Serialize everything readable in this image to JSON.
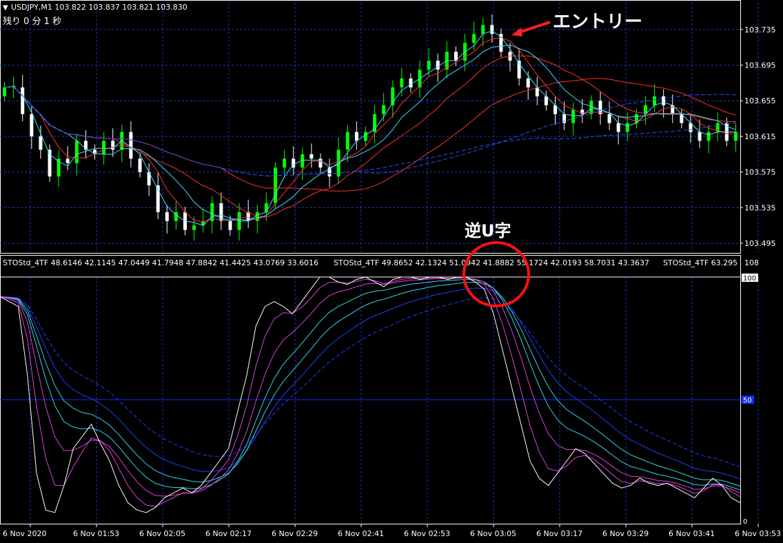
{
  "header": {
    "symbol_line": "USDJPY,M1  103.822 103.837 103.821 103.830",
    "countdown": "残り 0 分 1 秒"
  },
  "price_axis": [
    "103.735",
    "103.695",
    "103.655",
    "103.615",
    "103.575",
    "103.535",
    "103.495"
  ],
  "indicator": {
    "legend_a": "STOStd_4TF 48.6146 42.1145 47.0449 41.7948 47.8842 41.4425 43.0769 33.6016",
    "legend_b": "STOStd_4TF 49.8652 42.1324 51.0942 41.8882 55.1724 42.0193 58.7031 43.3637",
    "legend_c": "STOStd_4TF 63.295",
    "axis_top": "108",
    "axis_100": "100",
    "axis_50": "50",
    "axis_0": "0"
  },
  "time_axis": [
    "6 Nov 2020",
    "6 Nov 01:53",
    "6 Nov 02:05",
    "6 Nov 02:17",
    "6 Nov 02:29",
    "6 Nov 02:41",
    "6 Nov 02:53",
    "6 Nov 03:05",
    "6 Nov 03:17",
    "6 Nov 03:29",
    "6 Nov 03:41",
    "6 Nov 03:53"
  ],
  "annotations": {
    "entry": "エントリー",
    "inverse_u": "逆U字"
  },
  "colors": {
    "bull": "#00ff00",
    "bear": "#ffffff",
    "grid": "#1e3cc8",
    "axis": "#ffffff",
    "arrow": "#ff2020",
    "circle": "#ff1010",
    "ma_red": "#ff3030",
    "ma_cyan": "#40e0ff",
    "ma_blue": "#2850ff",
    "sto_main": "#ffffff",
    "sto_magenta": "#e040e0",
    "sto_cyan": "#30d8e8",
    "sto_blue": "#2040ff"
  },
  "chart_data": [
    {
      "type": "candlestick",
      "symbol": "USDJPY,M1",
      "ohlc_header": [
        103.822,
        103.837,
        103.821,
        103.83
      ],
      "y_ticks": [
        103.495,
        103.535,
        103.575,
        103.615,
        103.655,
        103.695,
        103.735
      ],
      "close": [
        103.67,
        103.672,
        103.64,
        103.615,
        103.6,
        103.57,
        103.59,
        103.585,
        103.61,
        103.6,
        103.595,
        103.61,
        103.6,
        103.62,
        103.59,
        103.575,
        103.56,
        103.53,
        103.52,
        103.53,
        103.51,
        103.515,
        103.52,
        103.54,
        103.52,
        103.51,
        103.53,
        103.52,
        103.53,
        103.54,
        103.58,
        103.59,
        103.58,
        103.595,
        103.59,
        103.58,
        103.57,
        103.6,
        103.62,
        103.61,
        103.62,
        103.64,
        103.65,
        103.67,
        103.68,
        103.67,
        103.69,
        103.7,
        103.69,
        103.71,
        103.7,
        103.72,
        103.73,
        103.74,
        103.73,
        103.71,
        103.7,
        103.68,
        103.67,
        103.66,
        103.65,
        103.64,
        103.63,
        103.645,
        103.64,
        103.655,
        103.64,
        103.63,
        103.62,
        103.63,
        103.64,
        103.65,
        103.66,
        103.65,
        103.64,
        103.63,
        103.62,
        103.61,
        103.62,
        103.63,
        103.61,
        103.62
      ],
      "open": [
        103.66,
        103.67,
        103.67,
        103.64,
        103.615,
        103.6,
        103.57,
        103.59,
        103.585,
        103.61,
        103.6,
        103.595,
        103.61,
        103.6,
        103.62,
        103.59,
        103.575,
        103.56,
        103.53,
        103.52,
        103.53,
        103.51,
        103.515,
        103.52,
        103.54,
        103.52,
        103.51,
        103.53,
        103.52,
        103.53,
        103.54,
        103.58,
        103.59,
        103.58,
        103.595,
        103.59,
        103.58,
        103.57,
        103.6,
        103.62,
        103.61,
        103.62,
        103.64,
        103.65,
        103.67,
        103.68,
        103.67,
        103.69,
        103.7,
        103.69,
        103.71,
        103.7,
        103.72,
        103.73,
        103.74,
        103.73,
        103.71,
        103.7,
        103.68,
        103.67,
        103.66,
        103.65,
        103.64,
        103.63,
        103.645,
        103.64,
        103.655,
        103.64,
        103.63,
        103.62,
        103.63,
        103.64,
        103.65,
        103.66,
        103.65,
        103.64,
        103.63,
        103.62,
        103.61,
        103.62,
        103.63,
        103.61
      ],
      "moving_averages": [
        {
          "color": "ma_red",
          "period": 5
        },
        {
          "color": "ma_red",
          "period": 13
        },
        {
          "color": "ma_red",
          "period": 25
        },
        {
          "color": "ma_cyan",
          "period": 3
        },
        {
          "color": "ma_cyan",
          "period": 8
        },
        {
          "color": "ma_blue",
          "period": 40
        },
        {
          "color": "ma_blue",
          "period": 60
        }
      ]
    },
    {
      "type": "line",
      "indicator": "STOStd_4TF",
      "ylim": [
        0,
        100
      ],
      "reference_lines": [
        50
      ],
      "main": [
        92,
        90,
        88,
        60,
        20,
        5,
        4,
        15,
        30,
        35,
        40,
        32,
        25,
        15,
        8,
        5,
        4,
        6,
        10,
        12,
        14,
        12,
        15,
        20,
        25,
        30,
        45,
        60,
        80,
        88,
        90,
        88,
        85,
        90,
        95,
        100,
        100,
        98,
        97,
        99,
        100,
        98,
        96,
        99,
        100,
        100,
        99,
        100,
        100,
        99,
        100,
        100,
        98,
        95,
        85,
        70,
        55,
        40,
        25,
        18,
        15,
        20,
        25,
        30,
        28,
        24,
        20,
        16,
        14,
        15,
        18,
        16,
        15,
        16,
        14,
        12,
        10,
        14,
        18,
        15,
        10,
        8
      ],
      "series": [
        {
          "name": "",
          "color": "sto_magenta",
          "lag": 3
        },
        {
          "name": "",
          "color": "sto_magenta",
          "lag": 6
        },
        {
          "name": "",
          "color": "sto_cyan",
          "lag": 9
        },
        {
          "name": "",
          "color": "sto_cyan",
          "lag": 12
        },
        {
          "name": "",
          "color": "sto_blue",
          "lag": 16
        },
        {
          "name": "",
          "color": "sto_blue",
          "lag": 22
        }
      ]
    }
  ]
}
